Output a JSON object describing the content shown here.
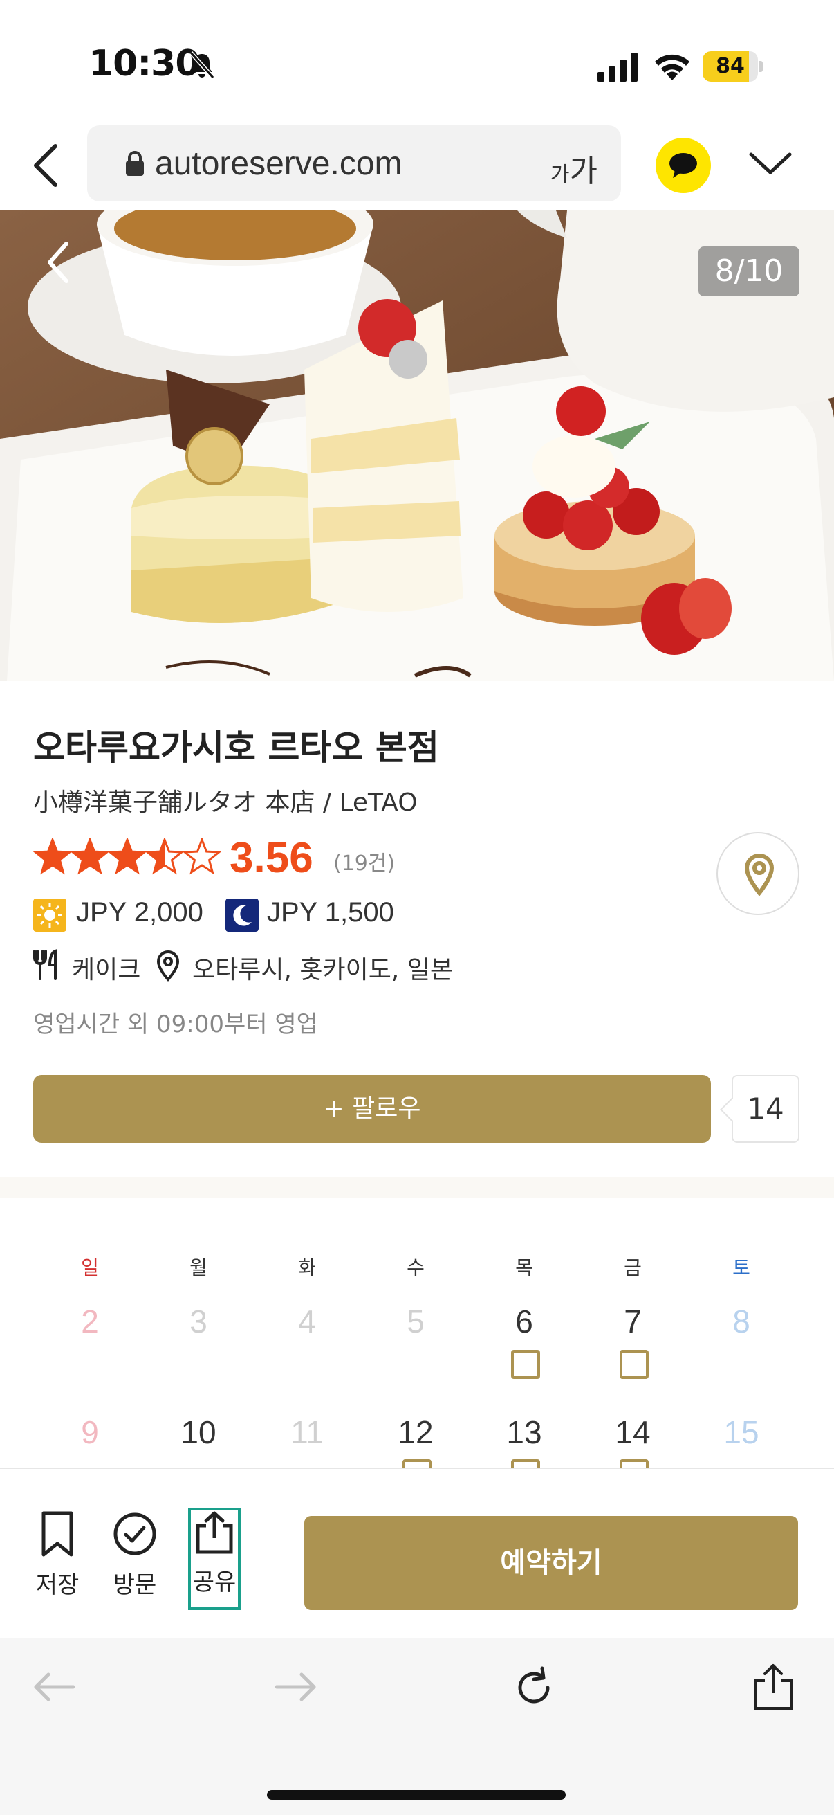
{
  "status_bar": {
    "time": "10:30",
    "battery": "84",
    "battery_level": 0.84
  },
  "browser": {
    "url": "autoreserve.com",
    "text_size_small": "가",
    "text_size_large": "가"
  },
  "gallery": {
    "counter": "8/10"
  },
  "restaurant": {
    "name": "오타루요가시호 르타오 본점",
    "original_name": "小樽洋菓子舗ルタオ 本店 / LeTAO",
    "rating": "3.56",
    "rating_value": 3.56,
    "review_count": "(19건)",
    "lunch_price": "JPY 2,000",
    "dinner_price": "JPY 1,500",
    "category": "케이크",
    "location": "오타루시, 홋카이도, 일본",
    "hours_note": "영업시간 외 09:00부터 영업"
  },
  "follow": {
    "label": "+ 팔로우",
    "count": "14"
  },
  "calendar": {
    "weekdays": [
      "일",
      "월",
      "화",
      "수",
      "목",
      "금",
      "토"
    ],
    "week1": [
      "2",
      "3",
      "4",
      "5",
      "6",
      "7",
      "8"
    ],
    "week2": [
      "9",
      "10",
      "11",
      "12",
      "13",
      "14",
      "15"
    ]
  },
  "actions": {
    "save": "저장",
    "visit": "방문",
    "share": "공유",
    "reserve": "예약하기"
  },
  "colors": {
    "gold": "#ac9351",
    "rating": "#ee4d1a",
    "kakao": "#fee500",
    "highlight": "#1aa08c"
  }
}
